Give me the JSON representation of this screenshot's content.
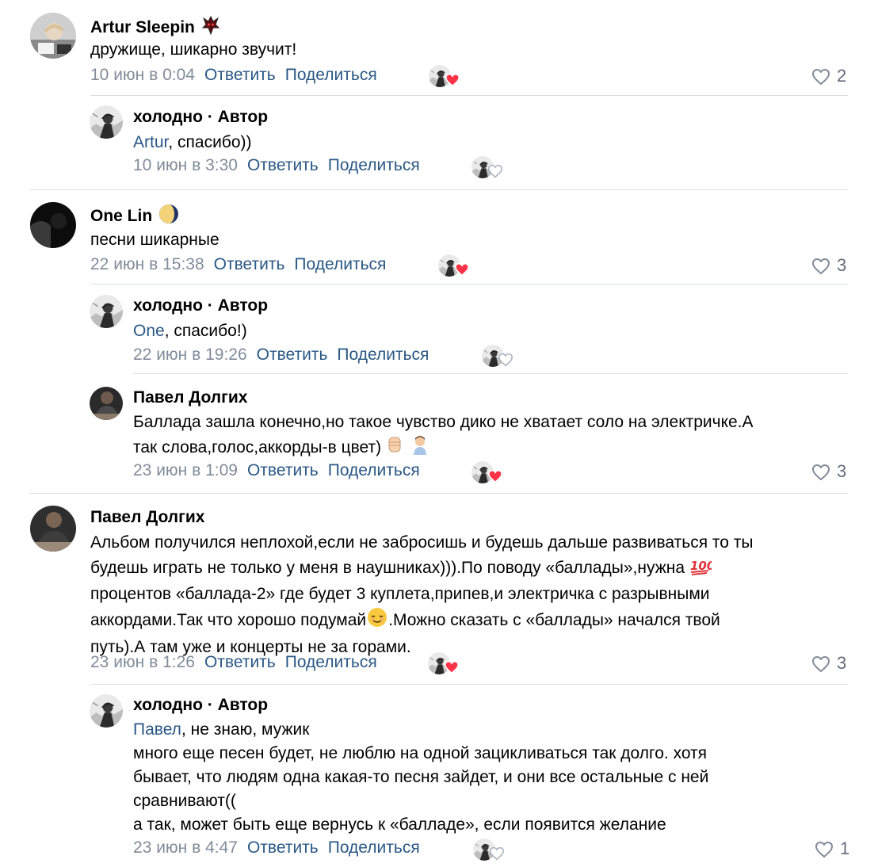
{
  "comments": [
    {
      "author": "Artur Sleepin",
      "text": "дружище, шикарно звучит!",
      "date": "10 июн в 0:04",
      "reply": "Ответить",
      "share": "Поделиться",
      "likes": "2",
      "liked_by_author": true
    },
    {
      "author": "холодно · Автор",
      "mention": "Artur",
      "text": ", спасибо))",
      "date": "10 июн в 3:30",
      "reply": "Ответить",
      "share": "Поделиться",
      "liked_by_author": false
    },
    {
      "author": "One Lin",
      "text": "песни шикарные",
      "date": "22 июн в 15:38",
      "reply": "Ответить",
      "share": "Поделиться",
      "likes": "3",
      "liked_by_author": true
    },
    {
      "author": "холодно · Автор",
      "mention": "One",
      "text": ", спасибо!)",
      "date": "22 июн в 19:26",
      "reply": "Ответить",
      "share": "Поделиться",
      "liked_by_author": false
    },
    {
      "author": "Павел Долгих",
      "lines": [
        "Баллада зашла конечно,но такое чувство дико не хватает соло на электричке.А",
        "так слова,голос,аккорды-в цвет)"
      ],
      "date": "23 июн в 1:09",
      "reply": "Ответить",
      "share": "Поделиться",
      "likes": "3",
      "liked_by_author": true
    },
    {
      "author": "Павел Долгих",
      "lines": [
        "Альбом получился неплохой,если не забросишь и будешь дальше развиваться то ты",
        "будешь играть не только у меня в наушниках))).По поводу «баллады»,нужна",
        "процентов «баллада-2» где будет 3 куплета,припев,и электричка с разрывными",
        "аккордами.Так что хорошо подумай",
        ".Можно сказать с «баллады» начался твой",
        "путь).А там уже и концерты не за горами."
      ],
      "date": "23 июн в 1:26",
      "reply": "Ответить",
      "share": "Поделиться",
      "likes": "3",
      "liked_by_author": true
    },
    {
      "author": "холодно · Автор",
      "mention": "Павел",
      "lines": [
        ", не знаю, мужик",
        "много еще песен будет, не люблю на одной зацикливаться так долго. хотя",
        "бывает, что людям одна какая-то песня зайдет, и они все остальные с ней",
        "сравнивают((",
        "а так, может быть еще вернусь к «балладе», если появится желание"
      ],
      "date": "23 июн в 4:47",
      "reply": "Ответить",
      "share": "Поделиться",
      "likes": "1",
      "liked_by_author": false
    }
  ],
  "colors": {
    "link": "#2a5885",
    "meta": "#818c99",
    "like_red": "#ff3347",
    "divider": "#dce1e6"
  }
}
